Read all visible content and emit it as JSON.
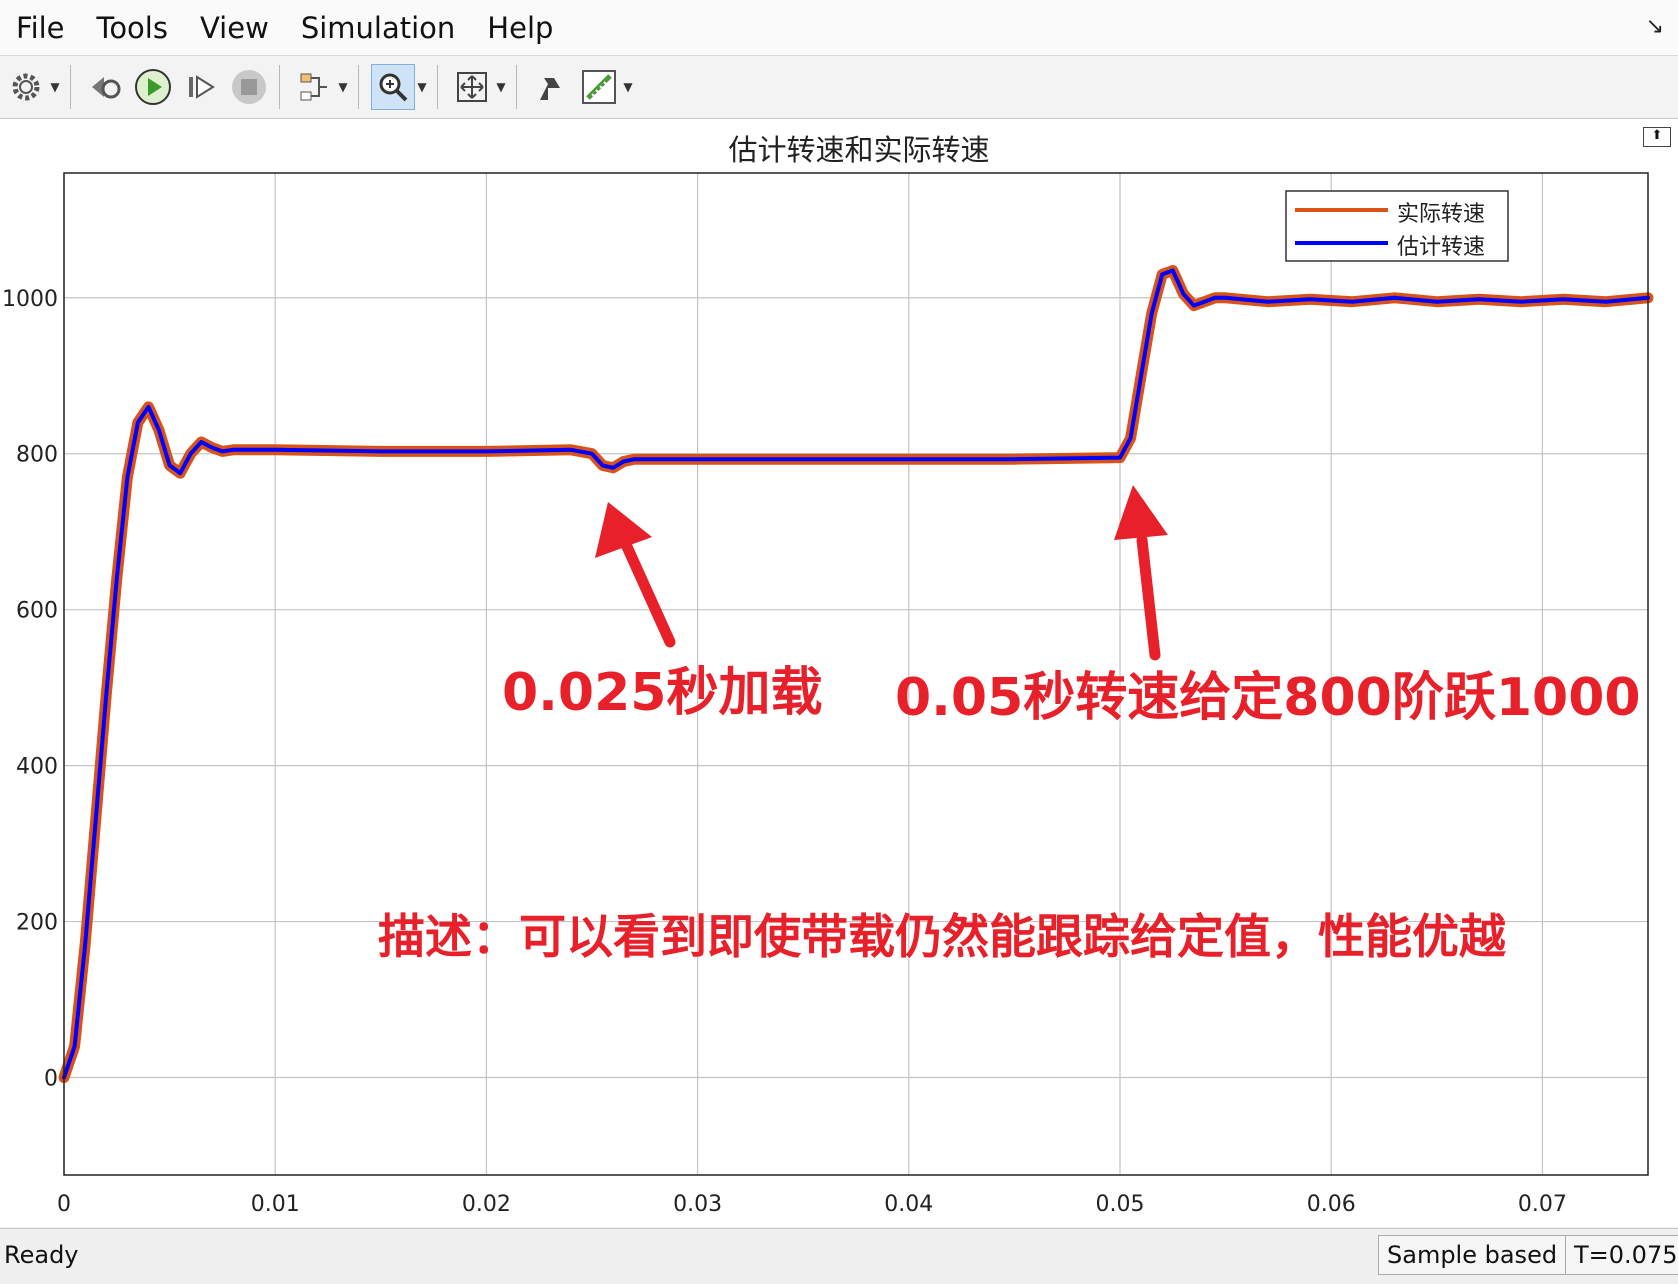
{
  "menu": [
    "File",
    "Tools",
    "View",
    "Simulation",
    "Help"
  ],
  "toolbar": {
    "icons": [
      "gear-icon",
      "step-back-icon",
      "run-icon",
      "step-forward-icon",
      "stop-icon",
      "signal-selector-icon",
      "zoom-icon",
      "autoscale-icon",
      "highlight-icon",
      "measurements-icon"
    ]
  },
  "chart_data": {
    "type": "line",
    "title": "估计转速和实际转速",
    "xlabel": "",
    "ylabel": "",
    "xlim": [
      0,
      0.075
    ],
    "ylim": [
      -125,
      1160
    ],
    "xticks": [
      0,
      0.01,
      0.02,
      0.03,
      0.04,
      0.05,
      0.06,
      0.07
    ],
    "xtick_labels": [
      "0",
      "0.01",
      "0.02",
      "0.03",
      "0.04",
      "0.05",
      "0.06",
      "0.07"
    ],
    "yticks": [
      0,
      200,
      400,
      600,
      800,
      1000
    ],
    "ytick_labels": [
      "0",
      "200",
      "400",
      "600",
      "800",
      "1000"
    ],
    "grid": true,
    "legend_position": "top-right",
    "series": [
      {
        "name": "实际转速",
        "color": "#D95319",
        "x": [
          0,
          0.0005,
          0.001,
          0.0015,
          0.002,
          0.0025,
          0.003,
          0.0035,
          0.004,
          0.0045,
          0.005,
          0.0055,
          0.006,
          0.0065,
          0.007,
          0.0075,
          0.008,
          0.01,
          0.015,
          0.02,
          0.024,
          0.025,
          0.0255,
          0.026,
          0.0265,
          0.027,
          0.03,
          0.035,
          0.04,
          0.045,
          0.05,
          0.0505,
          0.051,
          0.0515,
          0.052,
          0.0525,
          0.053,
          0.0535,
          0.054,
          0.0545,
          0.055,
          0.057,
          0.059,
          0.061,
          0.063,
          0.065,
          0.067,
          0.069,
          0.071,
          0.073,
          0.075
        ],
        "y": [
          0,
          40,
          170,
          330,
          490,
          640,
          770,
          840,
          860,
          830,
          785,
          775,
          800,
          815,
          808,
          803,
          805,
          805,
          803,
          803,
          805,
          800,
          785,
          782,
          790,
          793,
          793,
          793,
          793,
          793,
          795,
          820,
          900,
          980,
          1030,
          1035,
          1005,
          990,
          995,
          1000,
          1000,
          995,
          998,
          995,
          1000,
          995,
          998,
          995,
          998,
          995,
          1000
        ]
      },
      {
        "name": "估计转速",
        "color": "#0000FF",
        "x": [
          0,
          0.0005,
          0.001,
          0.0015,
          0.002,
          0.0025,
          0.003,
          0.0035,
          0.004,
          0.0045,
          0.005,
          0.0055,
          0.006,
          0.0065,
          0.007,
          0.0075,
          0.008,
          0.01,
          0.015,
          0.02,
          0.024,
          0.025,
          0.0255,
          0.026,
          0.0265,
          0.027,
          0.03,
          0.035,
          0.04,
          0.045,
          0.05,
          0.0505,
          0.051,
          0.0515,
          0.052,
          0.0525,
          0.053,
          0.0535,
          0.054,
          0.0545,
          0.055,
          0.057,
          0.059,
          0.061,
          0.063,
          0.065,
          0.067,
          0.069,
          0.071,
          0.073,
          0.075
        ],
        "y": [
          0,
          40,
          170,
          330,
          490,
          640,
          770,
          840,
          860,
          830,
          785,
          775,
          800,
          815,
          808,
          803,
          805,
          805,
          803,
          803,
          805,
          800,
          785,
          782,
          790,
          793,
          793,
          793,
          793,
          793,
          795,
          820,
          900,
          980,
          1030,
          1035,
          1005,
          990,
          995,
          1000,
          1000,
          995,
          998,
          995,
          1000,
          995,
          998,
          995,
          998,
          995,
          1000
        ]
      }
    ],
    "annotations": [
      {
        "text": "0.025秒加载",
        "arrow_to": [
          0.0258,
          785
        ]
      },
      {
        "text": "0.05秒转速给定800阶跃1000",
        "arrow_to": [
          0.0503,
          780
        ]
      },
      {
        "text": "描述：可以看到即使带载仍然能跟踪给定值，性能优越"
      }
    ]
  },
  "status": {
    "left": "Ready",
    "mode": "Sample based",
    "time": "T=0.075"
  }
}
